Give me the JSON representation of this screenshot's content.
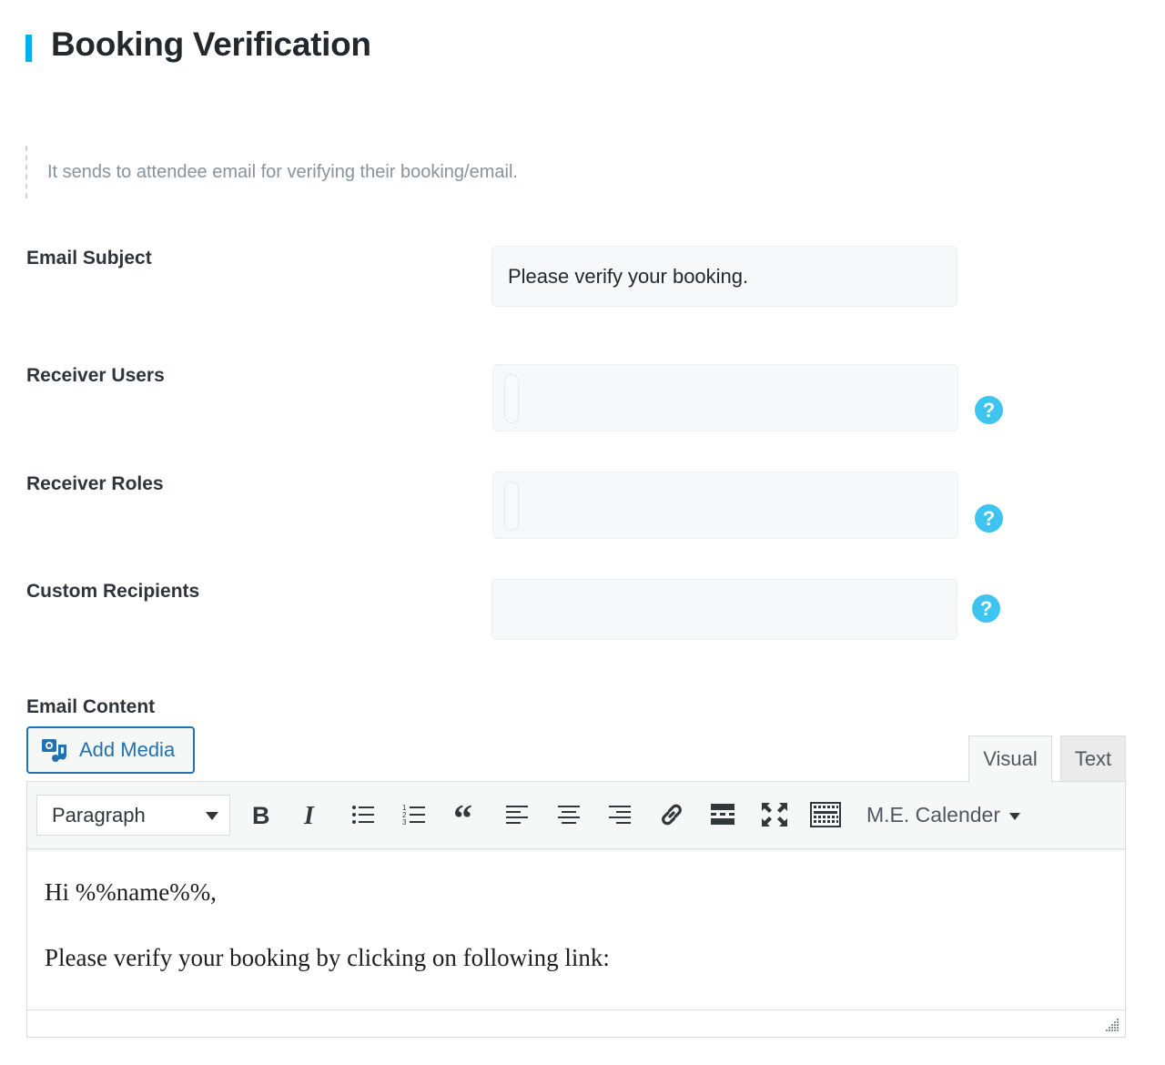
{
  "page": {
    "title": "Booking Verification",
    "description": "It sends to attendee email for verifying their booking/email.",
    "accent_color": "#00b0ea"
  },
  "form": {
    "email_subject": {
      "label": "Email Subject",
      "value": "Please verify your booking."
    },
    "receiver_users": {
      "label": "Receiver Users",
      "value": "",
      "help_icon": "question-circle-icon"
    },
    "receiver_roles": {
      "label": "Receiver Roles",
      "value": "",
      "help_icon": "question-circle-icon"
    },
    "custom_recipients": {
      "label": "Custom Recipients",
      "value": "",
      "help_icon": "question-circle-icon"
    },
    "help_glyph": "?"
  },
  "editor": {
    "label": "Email Content",
    "add_media_label": "Add Media",
    "tabs": {
      "visual": "Visual",
      "text": "Text",
      "active": "visual"
    },
    "format_select": "Paragraph",
    "toolbar_icons": [
      "bold-icon",
      "italic-icon",
      "bulleted-list-icon",
      "numbered-list-icon",
      "blockquote-icon",
      "align-left-icon",
      "align-center-icon",
      "align-right-icon",
      "link-icon",
      "read-more-icon",
      "fullscreen-icon",
      "toolbar-toggle-icon"
    ],
    "shortcode_menu": "M.E. Calender",
    "content": {
      "line1": "Hi %%name%%,",
      "line2": "Please verify your booking by clicking on following link:"
    }
  }
}
